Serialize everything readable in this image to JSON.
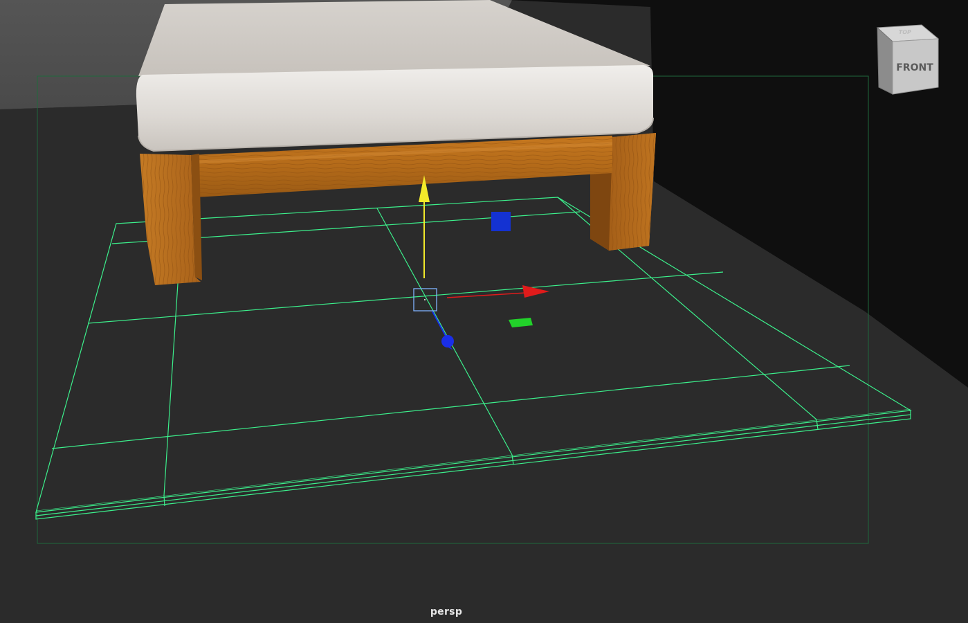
{
  "viewport": {
    "camera_name": "persp",
    "background_color": "#2b2b2b"
  },
  "view_cube": {
    "front_label": "FRONT",
    "top_label": "TOP"
  },
  "scene": {
    "objects": [
      "bed-mattress",
      "bed-frame",
      "floor-plane"
    ],
    "selected_object": "floor-plane",
    "selection_wireframe_color": "#3cf08c",
    "manipulator": {
      "type": "move",
      "axis_colors": {
        "x": "#e01b1b",
        "y": "#f2ea2a",
        "z": "#1a2ee8"
      },
      "plane_handle_colors": {
        "xy": "#1432d2",
        "xz": "#22d22a"
      }
    }
  }
}
